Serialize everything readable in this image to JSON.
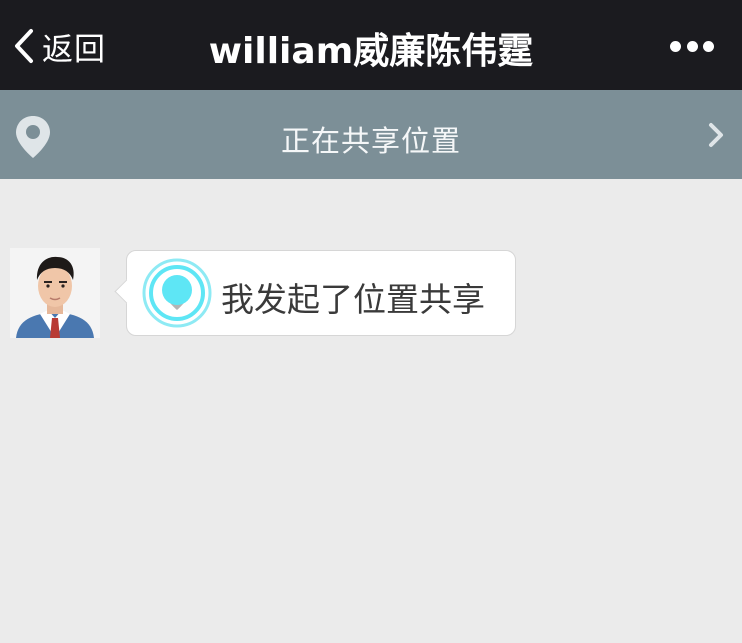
{
  "nav": {
    "back_label": "返回",
    "title": "william威廉陈伟霆",
    "more_icon": "more-dots-icon"
  },
  "banner": {
    "icon": "location-pin-icon",
    "label": "正在共享位置",
    "chevron_icon": "chevron-right-icon"
  },
  "messages": [
    {
      "sender": "avatar",
      "icon": "location-share-icon",
      "text": "我发起了位置共享"
    }
  ],
  "colors": {
    "nav_bg": "#1b1b1f",
    "banner_bg": "#7c8f97",
    "chat_bg": "#ebebeb",
    "location_accent": "#5ee6f5"
  }
}
